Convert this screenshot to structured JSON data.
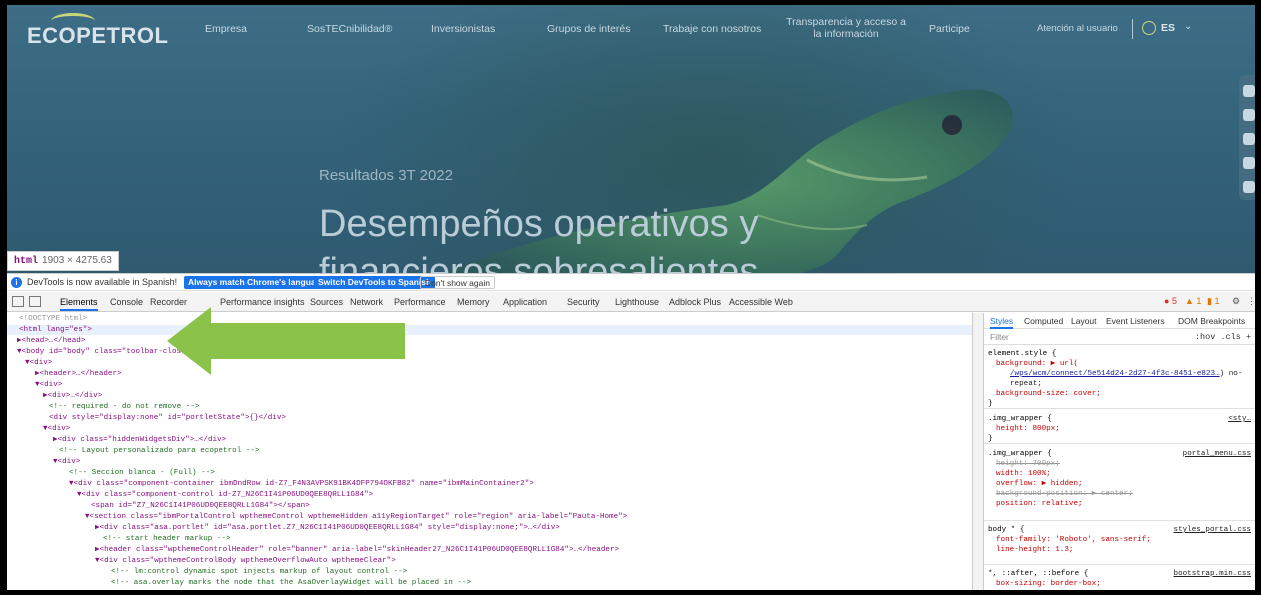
{
  "site": {
    "logo": "ECOPETROL",
    "nav": [
      "Empresa",
      "SosTECnibilidad®",
      "Inversionistas",
      "Grupos de interés",
      "Trabaje con nosotros",
      "Transparencia y acceso a la información",
      "Participe",
      "Atención al usuario"
    ],
    "lang": "ES",
    "hero_subtitle": "Resultados 3T 2022",
    "hero_title": "Desempeños operativos y financieros sobresalientes",
    "tooltip_tag": "html",
    "tooltip_size": "1903 × 4275.63"
  },
  "infobar": {
    "icon": "info-icon",
    "text": "DevTools is now available in Spanish!",
    "btn_match": "Always match Chrome's language",
    "btn_switch": "Switch DevTools to Spanish",
    "btn_dismiss": "Don't show again"
  },
  "tabs": [
    "Elements",
    "Console",
    "Recorder",
    "Performance insights",
    "Sources",
    "Network",
    "Performance",
    "Memory",
    "Application",
    "Security",
    "Lighthouse",
    "Adblock Plus",
    "Accessible Web"
  ],
  "status": {
    "errors": "5",
    "warnings": "1",
    "info": "1"
  },
  "dom": {
    "doctype": "<!DOCTYPE html>",
    "l1": "<html lang=\"es\">",
    "l2": "▶<head>…</head>",
    "l3": "▼<body id=\"body\" class=\"toolbar-closed\" screen_capture_injected=\"true\">",
    "l4": "▼<div>",
    "l5": "▶<header>…</header>",
    "l6": "▼<div>",
    "l7": "▶<div>…</div>",
    "l8": "<!-- required - do not remove -->",
    "l9": "<div style=\"display:none\" id=\"portletState\">{}</div>",
    "l10": "▼<div>",
    "l11": "▶<div class=\"hiddenWidgetsDiv\">…</div>",
    "l12": "<!-- Layout personalizado para ecopetrol -->",
    "l13": "▼<div>",
    "l14": "<!-- Seccion blanca - (Full) -->",
    "l15": "▼<div class=\"component-container ibmDndRow id-Z7_F4N3AVPSK91BK4DFP794OKFB82\" name=\"ibmMainContainer2\">",
    "l16": "▼<div class=\"component-control id-Z7_N26C1I41P06UD0QEE8QRLL1G84\">",
    "l17": "<span id=\"Z7_N26C1I41P06UD0QEE8QRLL1G84\"></span>",
    "l18": "▼<section class=\"ibmPortalControl wpthemeControl wpthemeHidden a11yRegionTarget\" role=\"region\" aria-label=\"Pauta-Home\">",
    "l19": "▶<div class=\"asa.portlet\" id=\"asa.portlet.Z7_N26C1I41P06UD0QEE8QRLL1G84\" style=\"display:none;\">…</div>",
    "l20": "<!-- start header markup -->",
    "l21": "▶<header class=\"wpthemeControlHeader\" role=\"banner\" aria-label=\"skinHeader27_N26C1I41P06UD0QEE8QRLL1G84\">…</header>",
    "l22": "▼<div class=\"wpthemeControlBody wpthemeOverflowAuto wpthemeClear\">",
    "l23": "<!-- lm:control dynamic spot injects markup of layout control -->",
    "l24": "<!-- asa.overlay marks the node that the AsaOverlayWidget will be placed in -->"
  },
  "styles": {
    "tabs": [
      "Styles",
      "Computed",
      "Layout",
      "Event Listeners",
      "DOM Breakpoints"
    ],
    "filter": "Filter",
    "filter_tools": ":hov  .cls  +",
    "r1_sel": "element.style {",
    "r1_p1": "background: ▶ url(",
    "r1_url": "/wps/wcm/connect/5e514d24-2d27-4f3c-8451-e823…",
    "r1_p1b": ") no-repeat;",
    "r1_p2": "background-size: cover;",
    "r2_sel": ".img_wrapper {",
    "r2_src": "<sty…",
    "r2_p1": "height: 800px;",
    "r3_sel": ".img_wrapper {",
    "r3_src": "portal_menu.css",
    "r3_p1": "height: 700px;",
    "r3_p2": "width: 100%;",
    "r3_p3": "overflow: ▶ hidden;",
    "r3_p4": "background-position: ▶ center;",
    "r3_p5": "position: relative;",
    "r4_sel": "body * {",
    "r4_src": "styles_portal.css",
    "r4_p1": "font-family: 'Roboto', sans-serif;",
    "r4_p2": "line-height: 1.3;",
    "r5_sel": "*, ::after, ::before {",
    "r5_src": "bootstrap.min.css",
    "r5_p1": "box-sizing: border-box;"
  },
  "colors": {
    "arrow": "#8bc34a",
    "accent": "#1a73e8"
  }
}
